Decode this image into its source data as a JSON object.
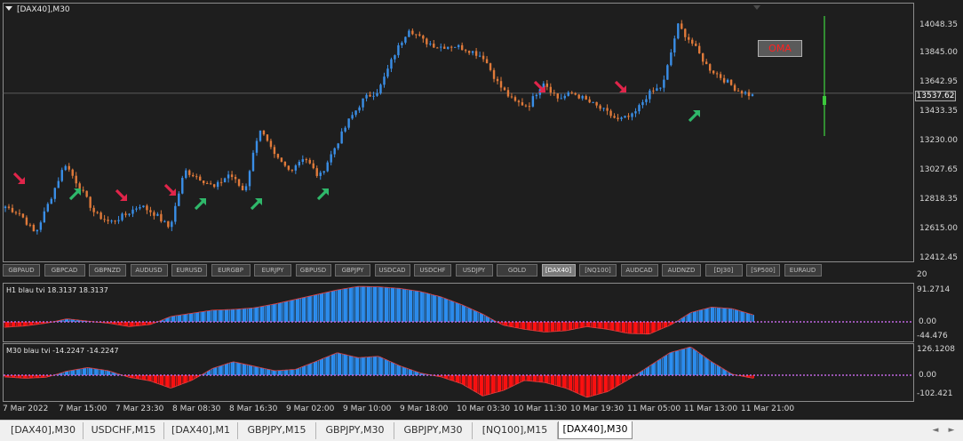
{
  "chart": {
    "title": "[DAX40],M30",
    "current_price": "13537.62",
    "oma_label": "OMA",
    "price_axis": [
      "14048.35",
      "13845.00",
      "13642.95",
      "13433.35",
      "13230.00",
      "13027.65",
      "12818.35",
      "12615.00",
      "12412.45"
    ],
    "colors": {
      "background": "#1e1e1e",
      "bull": "#3a8ee6",
      "bear": "#e07a3a",
      "buy_arrow": "#2fb86a",
      "sell_arrow": "#e0254a",
      "bar_line": "#3cc83c",
      "hist_pos": "#2c8ef0",
      "hist_neg": "#ff1010",
      "zero_line": "#c066e0"
    }
  },
  "symbol_bar": {
    "items": [
      "GBPAUD",
      "GBPCAD",
      "GBPNZD",
      "AUDUSD",
      "EURUSD",
      "EURGBP",
      "EURJPY",
      "GBPUSD",
      "GBPJPY",
      "USDCAD",
      "USDCHF",
      "USDJPY",
      "GOLD",
      "[DAX40]",
      "[NQ100]",
      "AUDCAD",
      "AUDNZD",
      "[DJ30]",
      "[SP500]",
      "EURAUD"
    ],
    "active": "[DAX40]"
  },
  "indicator_h1": {
    "title": "H1  blau tvi   18.3137 18.3137",
    "axis_top": "91.2714",
    "axis_zero": "0.00",
    "axis_bottom": "-44.476",
    "axis_top2": "20"
  },
  "indicator_m30": {
    "title": "M30  blau tvi   -14.2247 -14.2247",
    "axis_top": "126.1208",
    "axis_zero": "0.00",
    "axis_bottom": "-102.421"
  },
  "time_axis": [
    "7 Mar 2022",
    "7 Mar 15:00",
    "7 Mar 23:30",
    "8 Mar 08:30",
    "8 Mar 16:30",
    "9 Mar 02:00",
    "9 Mar 10:00",
    "9 Mar 18:00",
    "10 Mar 03:30",
    "10 Mar 11:30",
    "10 Mar 19:30",
    "11 Mar 05:00",
    "11 Mar 13:00",
    "11 Mar 21:00"
  ],
  "tabs": {
    "items": [
      "[DAX40],M30",
      "USDCHF,M15",
      "[DAX40],M1",
      "GBPJPY,M15",
      "GBPJPY,M30",
      "GBPJPY,M30",
      "[NQ100],M15",
      "[DAX40],M30"
    ],
    "active_index": 7,
    "prev_label": "◄",
    "next_label": "►"
  },
  "chart_data": {
    "type": "candlestick",
    "title": "[DAX40],M30",
    "x": [
      "7 Mar 2022",
      "7 Mar 15:00",
      "7 Mar 23:30",
      "8 Mar 08:30",
      "8 Mar 16:30",
      "9 Mar 02:00",
      "9 Mar 10:00",
      "9 Mar 18:00",
      "10 Mar 03:30",
      "10 Mar 11:30",
      "10 Mar 19:30",
      "11 Mar 05:00",
      "11 Mar 13:00",
      "11 Mar 21:00"
    ],
    "close_path": [
      12750,
      12700,
      12560,
      12800,
      13050,
      12880,
      12700,
      12640,
      12690,
      12760,
      12700,
      12600,
      13000,
      12950,
      12880,
      12980,
      12850,
      13300,
      13100,
      13000,
      13100,
      12950,
      13150,
      13350,
      13500,
      13560,
      13800,
      13990,
      13900,
      13860,
      13870,
      13840,
      13790,
      13600,
      13480,
      13450,
      13620,
      13500,
      13540,
      13480,
      13420,
      13350,
      13380,
      13530,
      13590,
      14010,
      13880,
      13720,
      13640,
      13560,
      13520
    ],
    "ylim": [
      12412.45,
      14130
    ],
    "signals": {
      "sell": [
        12,
        127,
        182,
        598,
        689
      ],
      "buy": [
        75,
        216,
        279,
        354,
        772
      ]
    },
    "indicators": [
      {
        "name": "H1  blau tvi",
        "values": [
          -16,
          -12,
          -4,
          8,
          2,
          -4,
          -14,
          -8,
          14,
          22,
          30,
          32,
          36,
          46,
          58,
          70,
          82,
          91,
          90,
          86,
          78,
          64,
          44,
          20,
          -10,
          -22,
          -30,
          -26,
          -14,
          -22,
          -34,
          -36,
          -10,
          24,
          38,
          34,
          18
        ]
      },
      {
        "name": "M30  blau tvi",
        "values": [
          -8,
          -14,
          -10,
          18,
          34,
          20,
          -10,
          -26,
          -60,
          -24,
          30,
          60,
          40,
          20,
          26,
          62,
          100,
          78,
          84,
          42,
          10,
          -8,
          -40,
          -96,
          -70,
          -24,
          -34,
          -60,
          -102,
          -76,
          -20,
          40,
          100,
          126,
          60,
          4,
          -14
        ]
      }
    ]
  }
}
